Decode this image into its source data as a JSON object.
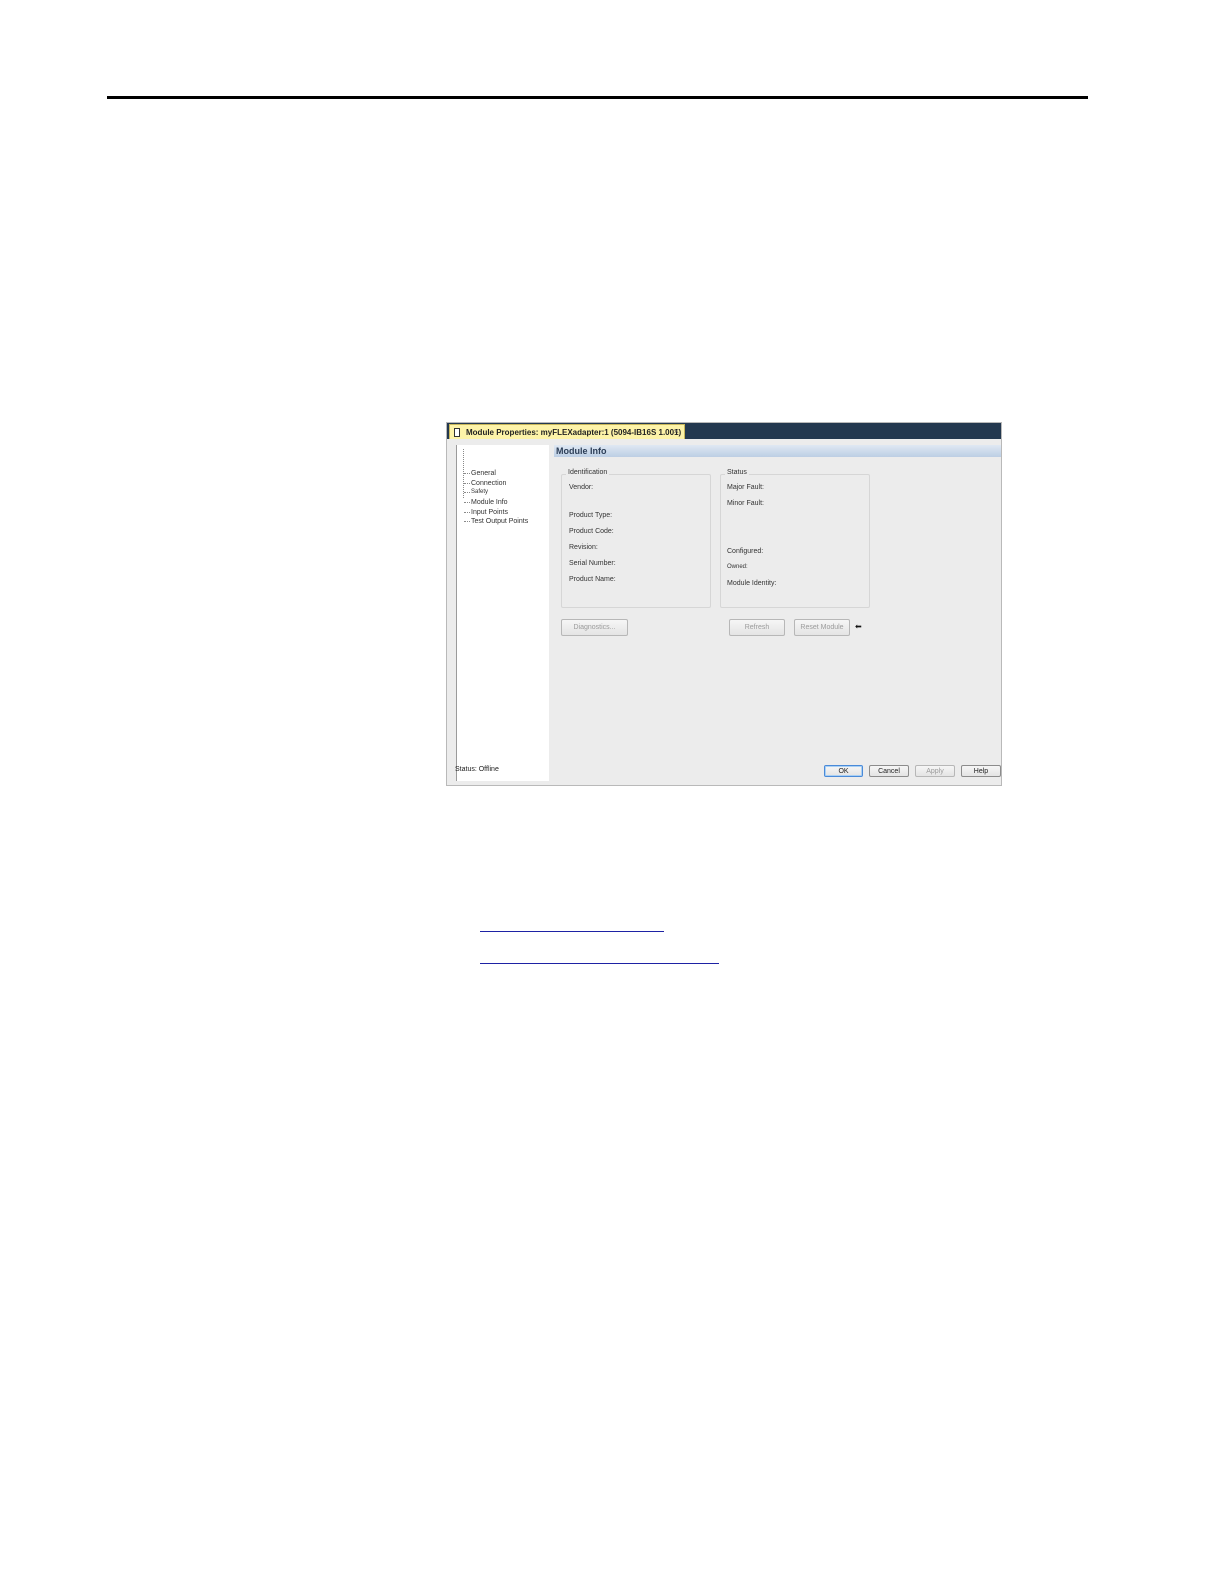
{
  "dialog": {
    "tab_title": "Module Properties: myFLEXadapter:1 (5094-IB16S 1.001)",
    "tab_close": "×",
    "tree": [
      "General",
      "Connection",
      "Safety",
      "Module Info",
      "Input Points",
      "Test Output Points"
    ],
    "section_title": "Module Info",
    "identification": {
      "title": "Identification",
      "fields": [
        "Vendor:",
        "Product Type:",
        "Product Code:",
        "Revision:",
        "Serial Number:",
        "Product Name:"
      ]
    },
    "status": {
      "title": "Status",
      "fields": [
        "Major Fault:",
        "Minor Fault:",
        "Configured:",
        "Owned:",
        "Module Identity:"
      ]
    },
    "buttons": {
      "diagnostics": "Diagnostics...",
      "refresh": "Refresh",
      "reset_module": "Reset Module",
      "ok": "OK",
      "cancel": "Cancel",
      "apply": "Apply",
      "help": "Help"
    },
    "arrow": "⬅",
    "status_bar": "Status:  Offline"
  }
}
